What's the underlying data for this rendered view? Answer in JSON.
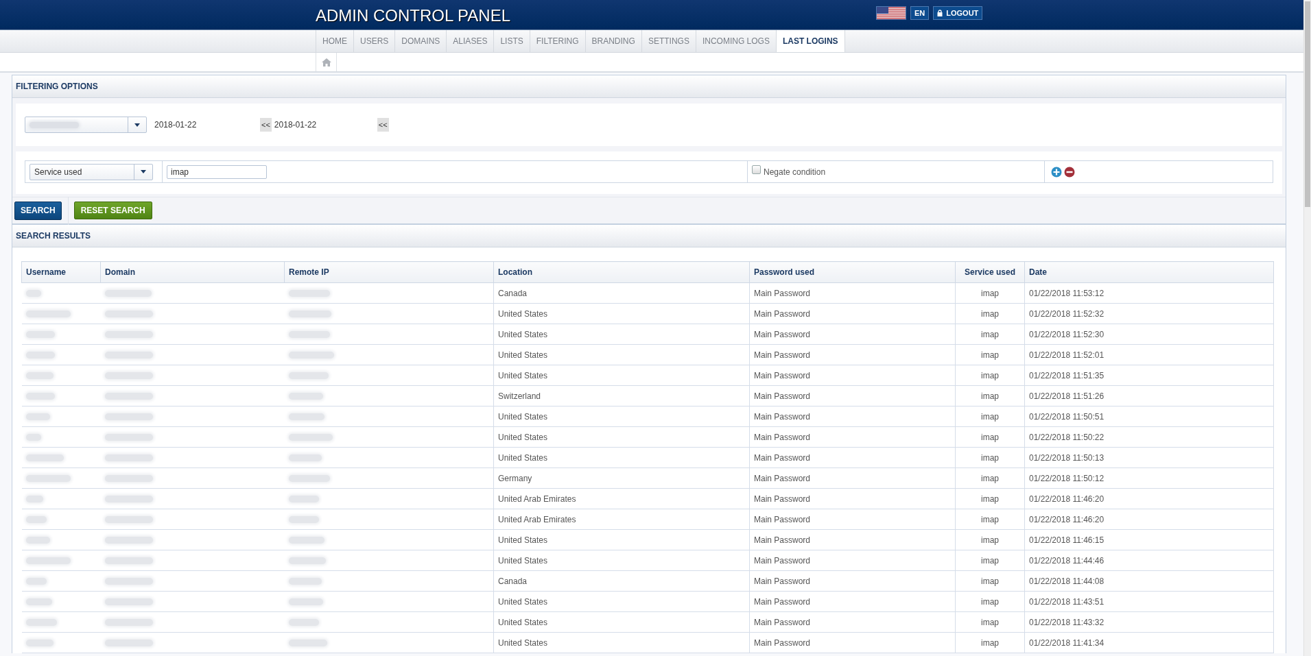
{
  "header": {
    "title": "ADMIN CONTROL PANEL",
    "language": "EN",
    "logout": "LOGOUT"
  },
  "tabs": [
    {
      "label": "HOME",
      "selected": false
    },
    {
      "label": "USERS",
      "selected": false
    },
    {
      "label": "DOMAINS",
      "selected": false
    },
    {
      "label": "ALIASES",
      "selected": false
    },
    {
      "label": "LISTS",
      "selected": false
    },
    {
      "label": "FILTERING",
      "selected": false
    },
    {
      "label": "BRANDING",
      "selected": false
    },
    {
      "label": "SETTINGS",
      "selected": false
    },
    {
      "label": "INCOMING LOGS",
      "selected": false
    },
    {
      "label": "LAST LOGINS",
      "selected": true
    }
  ],
  "filtering": {
    "title": "FILTERING OPTIONS",
    "date_from": "2018-01-22",
    "date_from_button": "<<",
    "date_to": "2018-01-22",
    "date_to_button": "<<",
    "condition": {
      "field": "Service used",
      "value": "imap",
      "negate_label": "Negate condition",
      "negate_checked": false
    }
  },
  "buttons": [
    {
      "label": "SEARCH",
      "kind": "primary"
    },
    {
      "label": "RESET SEARCH",
      "kind": "reset"
    }
  ],
  "results": {
    "title": "SEARCH RESULTS",
    "columns": [
      "Username",
      "Domain",
      "Remote IP",
      "Location",
      "Password used",
      "Service used",
      "Date"
    ],
    "rows": [
      {
        "location": "Canada",
        "password": "Main Password",
        "service": "imap",
        "date": "01/22/2018 11:53:12"
      },
      {
        "location": "United States",
        "password": "Main Password",
        "service": "imap",
        "date": "01/22/2018 11:52:32"
      },
      {
        "location": "United States",
        "password": "Main Password",
        "service": "imap",
        "date": "01/22/2018 11:52:30"
      },
      {
        "location": "United States",
        "password": "Main Password",
        "service": "imap",
        "date": "01/22/2018 11:52:01"
      },
      {
        "location": "United States",
        "password": "Main Password",
        "service": "imap",
        "date": "01/22/2018 11:51:35"
      },
      {
        "location": "Switzerland",
        "password": "Main Password",
        "service": "imap",
        "date": "01/22/2018 11:51:26"
      },
      {
        "location": "United States",
        "password": "Main Password",
        "service": "imap",
        "date": "01/22/2018 11:50:51"
      },
      {
        "location": "United States",
        "password": "Main Password",
        "service": "imap",
        "date": "01/22/2018 11:50:22"
      },
      {
        "location": "United States",
        "password": "Main Password",
        "service": "imap",
        "date": "01/22/2018 11:50:13"
      },
      {
        "location": "Germany",
        "password": "Main Password",
        "service": "imap",
        "date": "01/22/2018 11:50:12"
      },
      {
        "location": "United Arab Emirates",
        "password": "Main Password",
        "service": "imap",
        "date": "01/22/2018 11:46:20"
      },
      {
        "location": "United Arab Emirates",
        "password": "Main Password",
        "service": "imap",
        "date": "01/22/2018 11:46:20"
      },
      {
        "location": "United States",
        "password": "Main Password",
        "service": "imap",
        "date": "01/22/2018 11:46:15"
      },
      {
        "location": "United States",
        "password": "Main Password",
        "service": "imap",
        "date": "01/22/2018 11:44:46"
      },
      {
        "location": "Canada",
        "password": "Main Password",
        "service": "imap",
        "date": "01/22/2018 11:44:08"
      },
      {
        "location": "United States",
        "password": "Main Password",
        "service": "imap",
        "date": "01/22/2018 11:43:51"
      },
      {
        "location": "United States",
        "password": "Main Password",
        "service": "imap",
        "date": "01/22/2018 11:43:32"
      },
      {
        "location": "United States",
        "password": "Main Password",
        "service": "imap",
        "date": "01/22/2018 11:41:34"
      }
    ]
  }
}
